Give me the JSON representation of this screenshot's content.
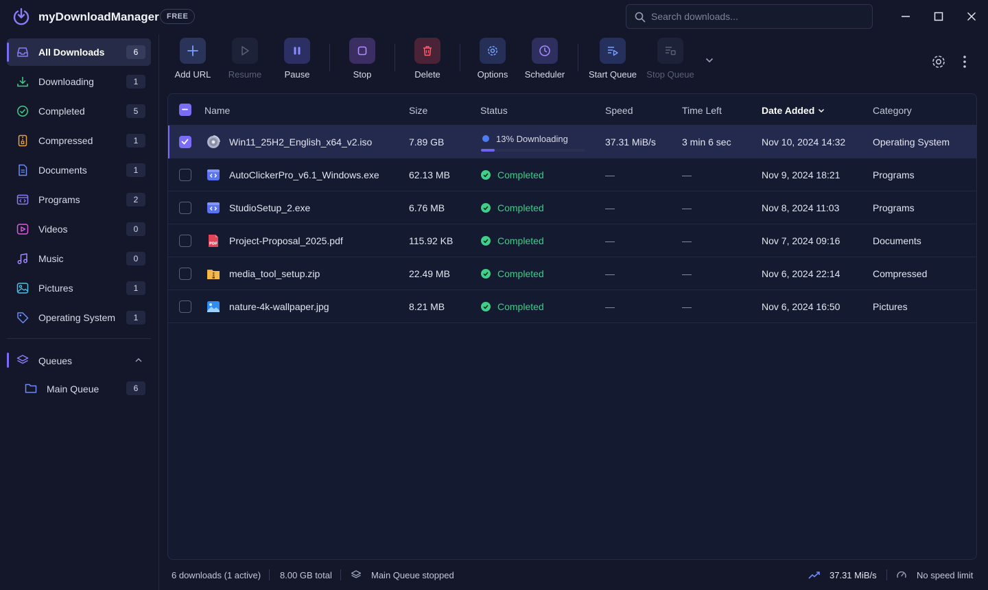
{
  "app": {
    "title": "myDownloadManager",
    "plan_badge": "FREE"
  },
  "search": {
    "placeholder": "Search downloads..."
  },
  "sidebar": {
    "items": [
      {
        "label": "All Downloads",
        "count": "6",
        "icon": "inbox-icon",
        "active": true
      },
      {
        "label": "Downloading",
        "count": "1",
        "icon": "download-icon"
      },
      {
        "label": "Completed",
        "count": "5",
        "icon": "check-circle-icon"
      },
      {
        "label": "Compressed",
        "count": "1",
        "icon": "archive-icon"
      },
      {
        "label": "Documents",
        "count": "1",
        "icon": "document-icon"
      },
      {
        "label": "Programs",
        "count": "2",
        "icon": "program-icon"
      },
      {
        "label": "Videos",
        "count": "0",
        "icon": "video-icon"
      },
      {
        "label": "Music",
        "count": "0",
        "icon": "music-icon"
      },
      {
        "label": "Pictures",
        "count": "1",
        "icon": "picture-icon"
      },
      {
        "label": "Operating System",
        "count": "1",
        "icon": "tag-icon"
      }
    ],
    "queues": {
      "label": "Queues",
      "items": [
        {
          "label": "Main Queue",
          "count": "6"
        }
      ]
    }
  },
  "toolbar": {
    "add_url": "Add URL",
    "resume": "Resume",
    "pause": "Pause",
    "stop": "Stop",
    "delete": "Delete",
    "options": "Options",
    "scheduler": "Scheduler",
    "start_queue": "Start Queue",
    "stop_queue": "Stop Queue"
  },
  "table": {
    "columns": [
      "Name",
      "Size",
      "Status",
      "Speed",
      "Time Left",
      "Date Added",
      "Category"
    ],
    "rows": [
      {
        "name": "Win11_25H2_English_x64_v2.iso",
        "size": "7.89 GB",
        "status": "13% Downloading",
        "progress": 0.13,
        "speed": "37.31 MiB/s",
        "time_left": "3 min 6 sec",
        "date_added": "Nov 10, 2024 14:32",
        "category": "Operating System",
        "icon": "disc-icon",
        "selected": true
      },
      {
        "name": "AutoClickerPro_v6.1_Windows.exe",
        "size": "62.13 MB",
        "status": "Completed",
        "speed": "—",
        "time_left": "—",
        "date_added": "Nov 9, 2024 18:21",
        "category": "Programs",
        "icon": "exe-icon"
      },
      {
        "name": "StudioSetup_2.exe",
        "size": "6.76 MB",
        "status": "Completed",
        "speed": "—",
        "time_left": "—",
        "date_added": "Nov 8, 2024 11:03",
        "category": "Programs",
        "icon": "exe-icon"
      },
      {
        "name": "Project-Proposal_2025.pdf",
        "size": "115.92 KB",
        "status": "Completed",
        "speed": "—",
        "time_left": "—",
        "date_added": "Nov 7, 2024 09:16",
        "category": "Documents",
        "icon": "pdf-icon",
        "icon_text": "PDF"
      },
      {
        "name": "media_tool_setup.zip",
        "size": "22.49 MB",
        "status": "Completed",
        "speed": "—",
        "time_left": "—",
        "date_added": "Nov 6, 2024 22:14",
        "category": "Compressed",
        "icon": "zip-icon"
      },
      {
        "name": "nature-4k-wallpaper.jpg",
        "size": "8.21 MB",
        "status": "Completed",
        "speed": "—",
        "time_left": "—",
        "date_added": "Nov 6, 2024 16:50",
        "category": "Pictures",
        "icon": "image-icon"
      }
    ]
  },
  "statusbar": {
    "downloads": "6 downloads (1 active)",
    "total": "8.00 GB total",
    "queue": "Main Queue stopped",
    "speed": "37.31 MiB/s",
    "limit": "No speed limit"
  },
  "colors": {
    "accent": "#7b6cf6",
    "success": "#3fcf86",
    "danger": "#e2455a",
    "background": "#131729"
  }
}
